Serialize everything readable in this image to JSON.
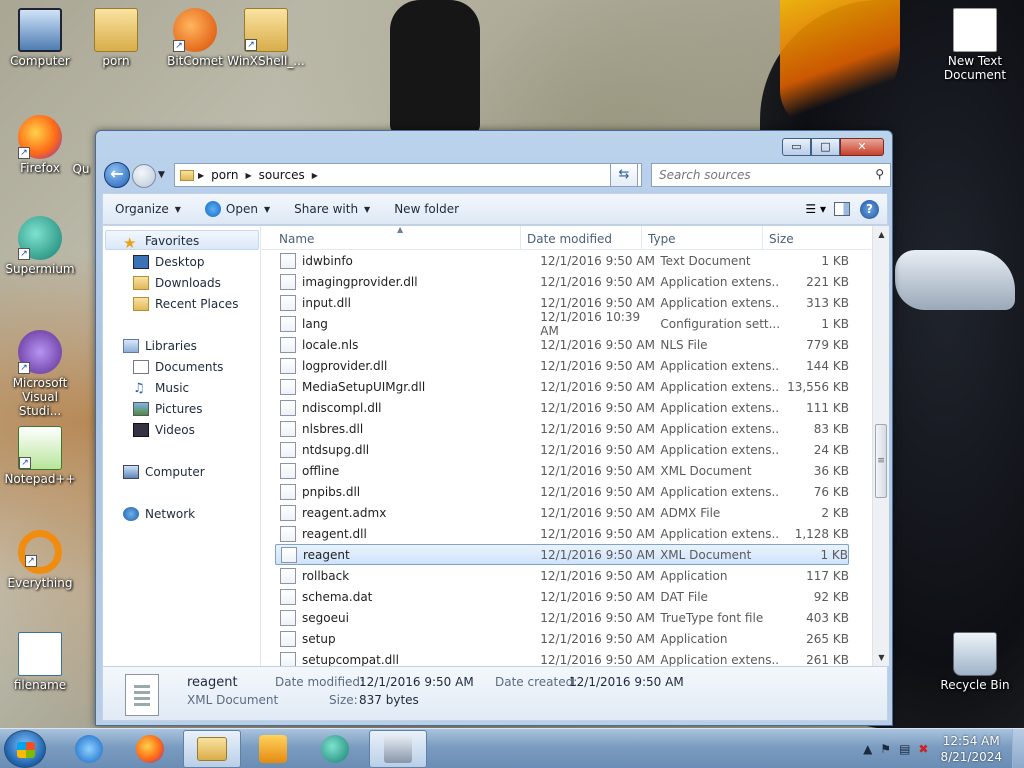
{
  "desktop": {
    "icons_left": [
      {
        "label": "Computer",
        "icon": "computer-icon"
      },
      {
        "label": "porn",
        "icon": "folder-icon"
      },
      {
        "label": "BitComet",
        "icon": "bitcomet-icon"
      },
      {
        "label": "WinXShell_...",
        "icon": "winxshell-icon"
      },
      {
        "label": "Firefox",
        "icon": "firefox-icon"
      },
      {
        "label": "Supermium",
        "icon": "supermium-icon"
      },
      {
        "label": "Microsoft Visual Studi...",
        "icon": "visual-studio-icon"
      },
      {
        "label": "Notepad++",
        "icon": "notepad-plus-plus-icon"
      },
      {
        "label": "Everything",
        "icon": "everything-search-icon"
      },
      {
        "label": "filename",
        "icon": "script-file-icon"
      }
    ],
    "partial_label": "Qu",
    "icons_right": [
      {
        "label": "New Text Document",
        "icon": "text-document-icon"
      },
      {
        "label": "Recycle Bin",
        "icon": "recycle-bin-icon"
      }
    ]
  },
  "window": {
    "caption": {
      "minimize": "▭",
      "maximize": "□",
      "close": "✕"
    },
    "breadcrumb": [
      "porn",
      "sources"
    ],
    "search_placeholder": "Search sources",
    "toolbar": {
      "organize": "Organize",
      "open": "Open",
      "share_with": "Share with",
      "new_folder": "New folder",
      "help": "?"
    },
    "nav": {
      "favorites": "Favorites",
      "desktop": "Desktop",
      "downloads": "Downloads",
      "recent_places": "Recent Places",
      "libraries": "Libraries",
      "documents": "Documents",
      "music": "Music",
      "pictures": "Pictures",
      "videos": "Videos",
      "computer": "Computer",
      "network": "Network"
    },
    "columns": {
      "name": "Name",
      "date": "Date modified",
      "type": "Type",
      "size": "Size"
    },
    "files": [
      {
        "name": "idwbinfo",
        "date": "12/1/2016 9:50 AM",
        "type": "Text Document",
        "size": "1 KB"
      },
      {
        "name": "imagingprovider.dll",
        "date": "12/1/2016 9:50 AM",
        "type": "Application extens...",
        "size": "221 KB"
      },
      {
        "name": "input.dll",
        "date": "12/1/2016 9:50 AM",
        "type": "Application extens...",
        "size": "313 KB"
      },
      {
        "name": "lang",
        "date": "12/1/2016 10:39 AM",
        "type": "Configuration sett...",
        "size": "1 KB"
      },
      {
        "name": "locale.nls",
        "date": "12/1/2016 9:50 AM",
        "type": "NLS File",
        "size": "779 KB"
      },
      {
        "name": "logprovider.dll",
        "date": "12/1/2016 9:50 AM",
        "type": "Application extens...",
        "size": "144 KB"
      },
      {
        "name": "MediaSetupUIMgr.dll",
        "date": "12/1/2016 9:50 AM",
        "type": "Application extens...",
        "size": "13,556 KB"
      },
      {
        "name": "ndiscompl.dll",
        "date": "12/1/2016 9:50 AM",
        "type": "Application extens...",
        "size": "111 KB"
      },
      {
        "name": "nlsbres.dll",
        "date": "12/1/2016 9:50 AM",
        "type": "Application extens...",
        "size": "83 KB"
      },
      {
        "name": "ntdsupg.dll",
        "date": "12/1/2016 9:50 AM",
        "type": "Application extens...",
        "size": "24 KB"
      },
      {
        "name": "offline",
        "date": "12/1/2016 9:50 AM",
        "type": "XML Document",
        "size": "36 KB"
      },
      {
        "name": "pnpibs.dll",
        "date": "12/1/2016 9:50 AM",
        "type": "Application extens...",
        "size": "76 KB"
      },
      {
        "name": "reagent.admx",
        "date": "12/1/2016 9:50 AM",
        "type": "ADMX File",
        "size": "2 KB"
      },
      {
        "name": "reagent.dll",
        "date": "12/1/2016 9:50 AM",
        "type": "Application extens...",
        "size": "1,128 KB"
      },
      {
        "name": "reagent",
        "date": "12/1/2016 9:50 AM",
        "type": "XML Document",
        "size": "1 KB"
      },
      {
        "name": "rollback",
        "date": "12/1/2016 9:50 AM",
        "type": "Application",
        "size": "117 KB"
      },
      {
        "name": "schema.dat",
        "date": "12/1/2016 9:50 AM",
        "type": "DAT File",
        "size": "92 KB"
      },
      {
        "name": "segoeui",
        "date": "12/1/2016 9:50 AM",
        "type": "TrueType font file",
        "size": "403 KB"
      },
      {
        "name": "setup",
        "date": "12/1/2016 9:50 AM",
        "type": "Application",
        "size": "265 KB"
      },
      {
        "name": "setupcompat.dll",
        "date": "12/1/2016 9:50 AM",
        "type": "Application extens...",
        "size": "261 KB"
      }
    ],
    "selected_index": 14,
    "details": {
      "name": "reagent",
      "type": "XML Document",
      "date_modified_label": "Date modified:",
      "date_modified": "12/1/2016 9:50 AM",
      "date_created_label": "Date created:",
      "date_created": "12/1/2016 9:50 AM",
      "size_label": "Size:",
      "size": "837 bytes"
    }
  },
  "taskbar": {
    "pinned": [
      "internet-explorer-icon",
      "firefox-icon",
      "explorer-icon",
      "media-player-icon",
      "supermium-icon",
      "network-tool-icon"
    ],
    "clock_time": "12:54 AM",
    "clock_date": "8/21/2024"
  }
}
